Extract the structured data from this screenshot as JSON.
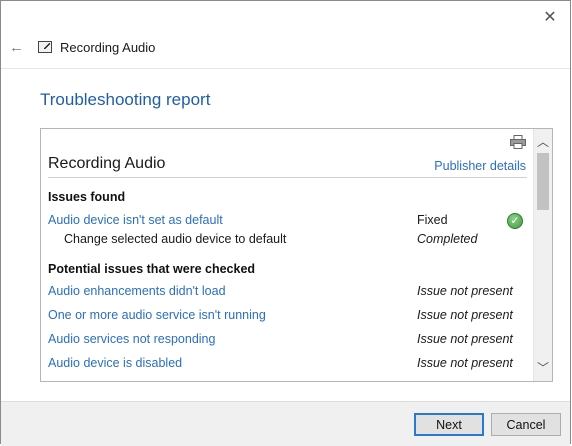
{
  "window": {
    "title": "Recording Audio",
    "close_glyph": "✕",
    "back_glyph": "←"
  },
  "page": {
    "title": "Troubleshooting report"
  },
  "report": {
    "heading": "Recording Audio",
    "publisher_link": "Publisher details",
    "issues_found_title": "Issues found",
    "issues_found": [
      {
        "label": "Audio device isn't set as default",
        "status": "Fixed",
        "status_icon": "green-check-icon",
        "sub_label": "Change selected audio device to default",
        "sub_status": "Completed"
      }
    ],
    "checked_title": "Potential issues that were checked",
    "checked": [
      {
        "label": "Audio enhancements didn't load",
        "status": "Issue not present"
      },
      {
        "label": "One or more audio service isn't running",
        "status": "Issue not present"
      },
      {
        "label": "Audio services not responding",
        "status": "Issue not present"
      },
      {
        "label": "Audio device is disabled",
        "status": "Issue not present"
      }
    ]
  },
  "footer": {
    "next_label": "Next",
    "cancel_label": "Cancel"
  },
  "colors": {
    "link": "#2b6fbf",
    "title_blue": "#1f5fa8",
    "check_green": "#3d9a3a",
    "primary_button_border": "#2b78d0"
  }
}
